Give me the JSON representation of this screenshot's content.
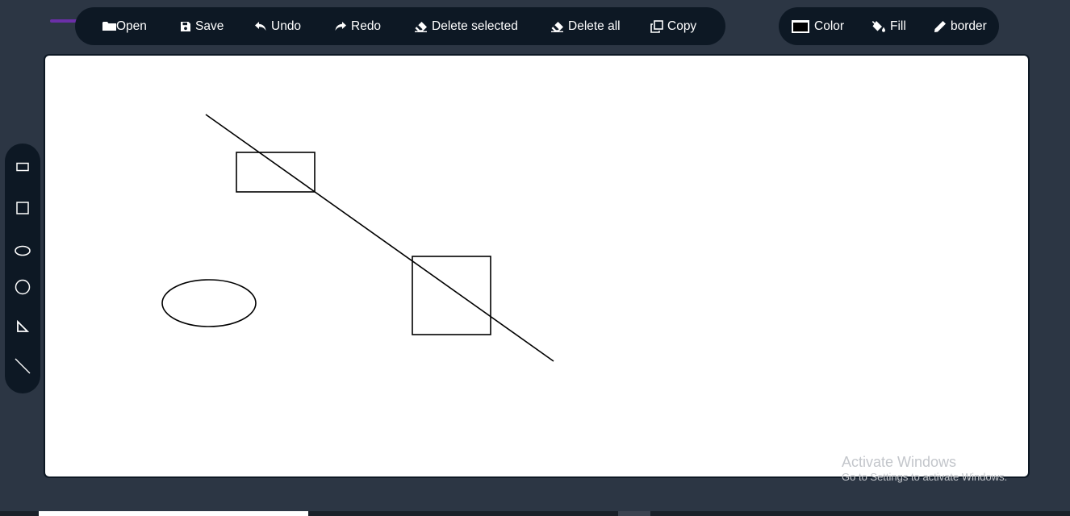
{
  "toolbar": {
    "open_label": "Open",
    "save_label": "Save",
    "undo_label": "Undo",
    "redo_label": "Redo",
    "delete_selected_label": "Delete selected",
    "delete_all_label": "Delete all",
    "copy_label": "Copy"
  },
  "style_toolbar": {
    "color_label": "Color",
    "fill_label": "Fill",
    "border_label": "border"
  },
  "shape_tools": [
    {
      "name": "rectangle-tool",
      "icon": "rectangle-icon"
    },
    {
      "name": "square-tool",
      "icon": "square-icon"
    },
    {
      "name": "ellipse-tool",
      "icon": "ellipse-icon"
    },
    {
      "name": "circle-tool",
      "icon": "circle-icon"
    },
    {
      "name": "triangle-tool",
      "icon": "right-triangle-icon"
    },
    {
      "name": "line-tool",
      "icon": "line-icon"
    }
  ],
  "canvas": {
    "background": "#ffffff",
    "stroke_color": "#000000",
    "shapes": [
      "line",
      "rectangle",
      "square",
      "ellipse"
    ]
  },
  "colors": {
    "page_bg": "#2c3644",
    "toolbar_bg": "#0d1824",
    "arrow_accent": "#6b2fa8"
  },
  "watermark": {
    "title": "Activate Windows",
    "subtitle": "Go to Settings to activate Windows."
  }
}
